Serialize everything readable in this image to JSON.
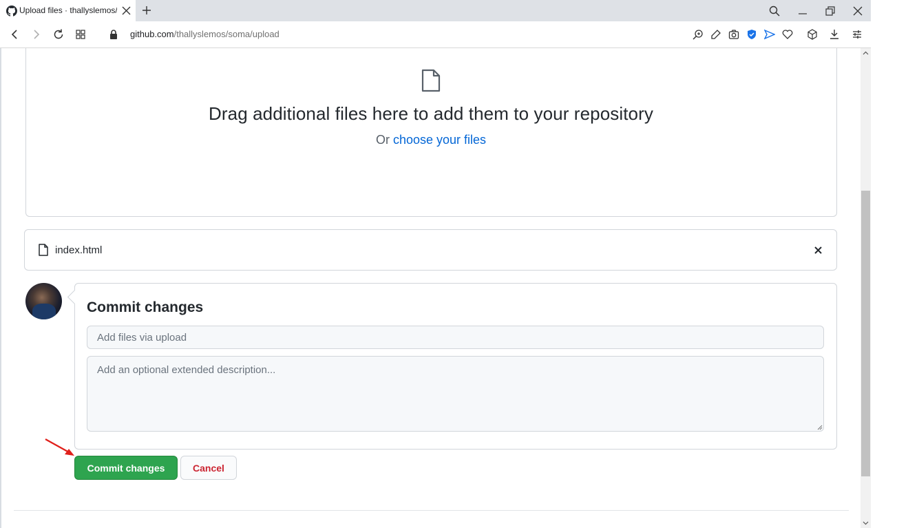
{
  "browser": {
    "tab_title": "Upload files · thallyslemos/",
    "url_host": "github.com",
    "url_path": "/thallyslemos/soma/upload"
  },
  "dropzone": {
    "icon": "file-icon",
    "title": "Drag additional files here to add them to your repository",
    "subtitle_prefix": "Or ",
    "subtitle_link": "choose your files"
  },
  "file": {
    "name": "index.html"
  },
  "commit": {
    "title": "Commit changes",
    "summary_placeholder": "Add files via upload",
    "description_placeholder": "Add an optional extended description..."
  },
  "actions": {
    "commit_label": "Commit changes",
    "cancel_label": "Cancel"
  },
  "colors": {
    "commit_button": "#2ea44f",
    "cancel_text": "#cb2431",
    "link": "#0366d6",
    "annotation_arrow": "#e0201b"
  }
}
